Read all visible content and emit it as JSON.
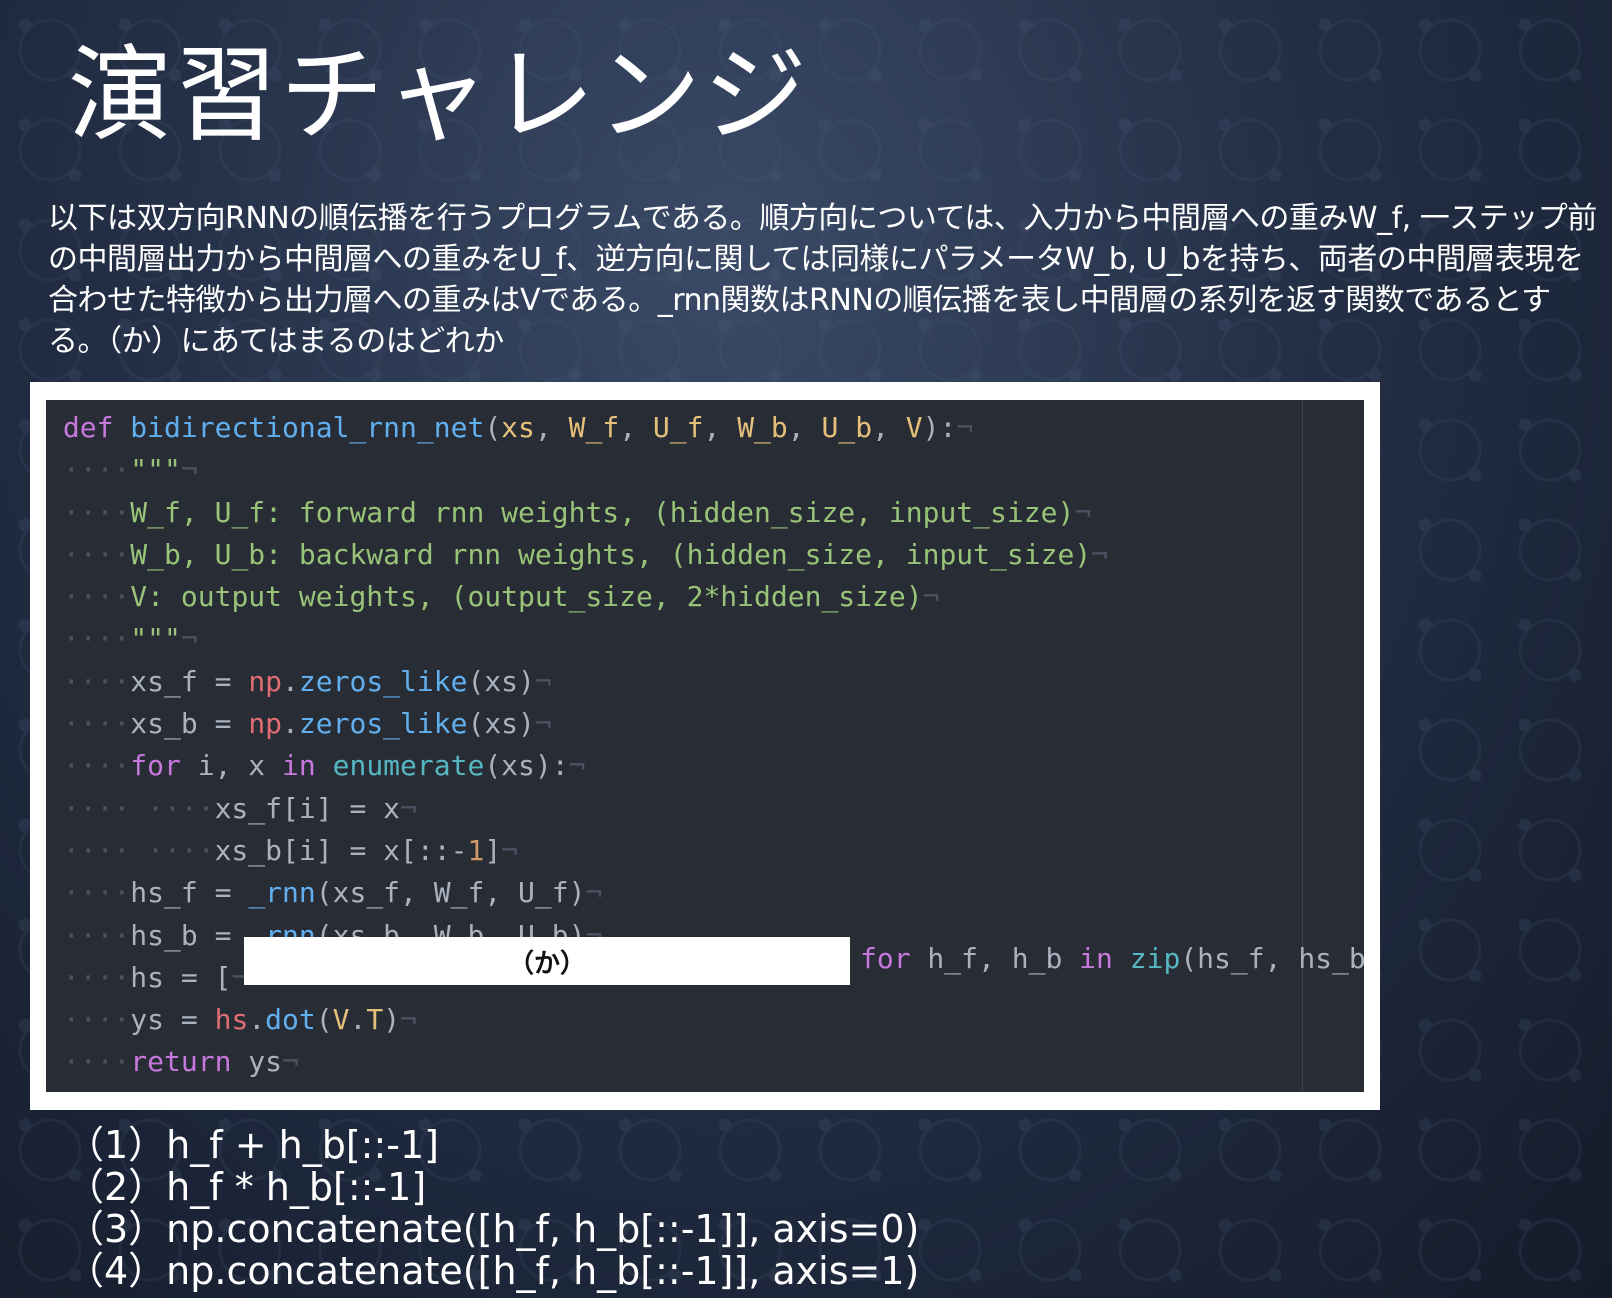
{
  "slide": {
    "title": "演習チャレンジ",
    "description": "以下は双方向RNNの順伝播を行うプログラムである。順方向については、入力から中間層への重みW_f, 一ステップ前の中間層出力から中間層への重みをU_f、逆方向に関しては同様にパラメータW_b, U_bを持ち、両者の中間層表現を合わせた特徴から出力層への重みはVである。_rnn関数はRNNの順伝播を表し中間層の系列を返す関数であるとする。（か）にあてはまるのはどれか"
  },
  "code": {
    "lines": [
      "def bidirectional_rnn_net(xs, W_f, U_f, W_b, U_b, V):",
      "\"\"\"",
      "W_f, U_f: forward rnn weights, (hidden_size, input_size)",
      "W_b, U_b: backward rnn weights, (hidden_size, input_size)",
      "V: output weights, (output_size, 2*hidden_size)",
      "\"\"\"",
      "xs_f = np.zeros_like(xs)",
      "xs_b = np.zeros_like(xs)",
      "for i, x in enumerate(xs):",
      "xs_f[i] = x",
      "xs_b[i] = x[::-1]",
      "hs_f = _rnn(xs_f, W_f, U_f)",
      "hs_b = _rnn(xs_b, W_b, U_b)",
      "hs = [",
      "ys = hs.dot(V.T)",
      "return ys"
    ],
    "blank_label": "（か）",
    "after_blank": "for h_f, h_b in zip(hs_f, hs_b)]"
  },
  "options": [
    "（1）h_f + h_b[::-1]",
    "（2）h_f * h_b[::-1]",
    "（3）np.concatenate([h_f, h_b[::-1]], axis=0)",
    "（4）np.concatenate([h_f, h_b[::-1]], axis=1)"
  ],
  "colors": {
    "code_background": "#282c34",
    "keyword": "#c678dd",
    "function": "#61afef",
    "parameter": "#e5c07b",
    "string": "#98c379",
    "number": "#d19a66",
    "module": "#e06c75"
  }
}
